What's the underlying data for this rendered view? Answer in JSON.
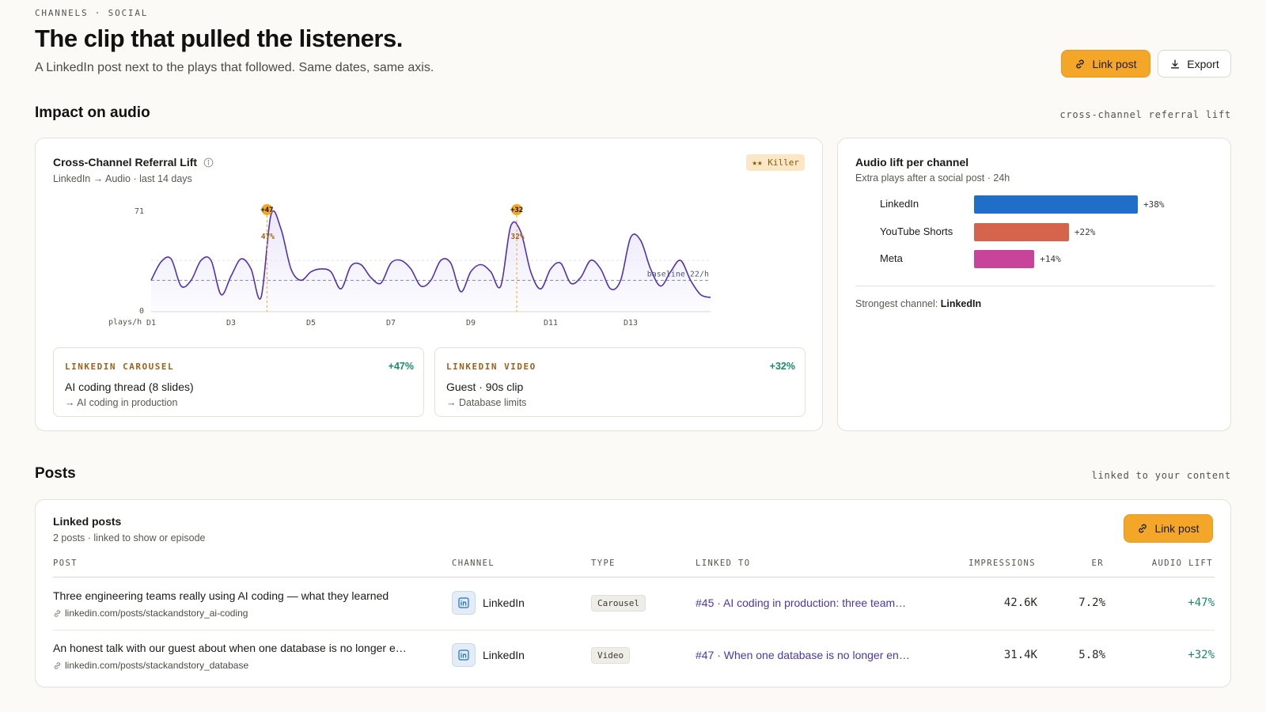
{
  "header": {
    "eyebrow": "CHANNELS · SOCIAL",
    "title": "The clip that pulled the listeners.",
    "subtitle": "A LinkedIn post next to the plays that followed. Same dates, same axis.",
    "link_post_label": "Link post",
    "export_label": "Export"
  },
  "impact": {
    "title": "Impact on audio",
    "hint": "cross-channel referral lift"
  },
  "referral_card": {
    "title": "Cross-Channel Referral Lift",
    "subtitle": "LinkedIn → Audio · last 14 days",
    "badge": "★★ Killer",
    "events": [
      {
        "kicker": "LINKEDIN CAROUSEL",
        "lift": "+47%",
        "title": "AI coding thread (8 slides)",
        "sub": "→ AI coding in production"
      },
      {
        "kicker": "LINKEDIN VIDEO",
        "lift": "+32%",
        "title": "Guest · 90s clip",
        "sub": "→ Database limits"
      }
    ]
  },
  "chart_data": [
    {
      "type": "area",
      "title": "",
      "ylabel": "plays/h",
      "y_ticks": [
        "0",
        "71"
      ],
      "ylim": [
        0,
        71
      ],
      "xlim": [
        0,
        14
      ],
      "x_ticks": [
        {
          "x": 0,
          "label": "D1"
        },
        {
          "x": 2,
          "label": "D3"
        },
        {
          "x": 4,
          "label": "D5"
        },
        {
          "x": 6,
          "label": "D7"
        },
        {
          "x": 8,
          "label": "D9"
        },
        {
          "x": 10,
          "label": "D11"
        },
        {
          "x": 12,
          "label": "D13"
        }
      ],
      "baseline": {
        "value": 22,
        "label": "baseline 22/h"
      },
      "grid_value": 36,
      "x": [
        0.0,
        0.25,
        0.5,
        0.75,
        1.0,
        1.25,
        1.5,
        1.75,
        2.0,
        2.25,
        2.5,
        2.75,
        3.0,
        3.25,
        3.5,
        3.75,
        4.0,
        4.25,
        4.5,
        4.75,
        5.0,
        5.25,
        5.5,
        5.75,
        6.0,
        6.25,
        6.5,
        6.75,
        7.0,
        7.25,
        7.5,
        7.75,
        8.0,
        8.25,
        8.5,
        8.75,
        9.0,
        9.25,
        9.5,
        9.75,
        10.0,
        10.25,
        10.5,
        10.75,
        11.0,
        11.25,
        11.5,
        11.75,
        12.0,
        12.25,
        12.5,
        12.75,
        13.0,
        13.25,
        13.5,
        13.75,
        14.0
      ],
      "values": [
        22,
        35,
        37,
        18,
        22,
        36,
        36,
        12,
        25,
        37,
        30,
        10,
        68,
        58,
        30,
        22,
        28,
        30,
        28,
        16,
        32,
        33,
        24,
        20,
        34,
        36,
        30,
        18,
        22,
        36,
        34,
        14,
        28,
        33,
        28,
        18,
        60,
        56,
        28,
        16,
        30,
        34,
        20,
        24,
        36,
        30,
        16,
        22,
        52,
        50,
        30,
        18,
        28,
        36,
        22,
        12,
        10
      ],
      "events": [
        {
          "x": 2.9,
          "label": "+47",
          "pct_label": "47%"
        },
        {
          "x": 9.15,
          "label": "+32",
          "pct_label": "32%"
        }
      ],
      "colors": {
        "line": "#5231b5",
        "fill": "#ece8fb",
        "event": "#f4a629",
        "baseline": "#7b8fb3"
      }
    },
    {
      "type": "bar",
      "orientation": "horizontal",
      "title": "Audio lift per channel",
      "subtitle": "Extra plays after a social post · 24h",
      "categories": [
        "LinkedIn",
        "YouTube Shorts",
        "Meta"
      ],
      "values": [
        38,
        22,
        14
      ],
      "value_labels": [
        "+38%",
        "+22%",
        "+14%"
      ],
      "colors": [
        "#1f6fc9",
        "#d4654c",
        "#c8439a"
      ],
      "xlim": [
        0,
        38
      ]
    }
  ],
  "channel_card": {
    "footer_prefix": "Strongest channel:",
    "footer_value": "LinkedIn"
  },
  "posts_section": {
    "title": "Posts",
    "hint": "linked to your content"
  },
  "posts_card": {
    "title": "Linked posts",
    "subtitle": "2 posts · linked to show or episode",
    "link_post_label": "Link post",
    "columns": [
      "POST",
      "CHANNEL",
      "TYPE",
      "LINKED TO",
      "IMPRESSIONS",
      "ER",
      "AUDIO LIFT"
    ],
    "rows": [
      {
        "post": "Three engineering teams really using AI coding — what they learned",
        "url": "linkedin.com/posts/stackandstory_ai-coding",
        "channel": "LinkedIn",
        "type": "Carousel",
        "linked_to": "#45 · AI coding in production: three team…",
        "impressions": "42.6K",
        "er": "7.2%",
        "lift": "+47%"
      },
      {
        "post": "An honest talk with our guest about when one database is no longer e…",
        "url": "linkedin.com/posts/stackandstory_database",
        "channel": "LinkedIn",
        "type": "Video",
        "linked_to": "#47 · When one database is no longer en…",
        "impressions": "31.4K",
        "er": "5.8%",
        "lift": "+32%"
      }
    ]
  }
}
